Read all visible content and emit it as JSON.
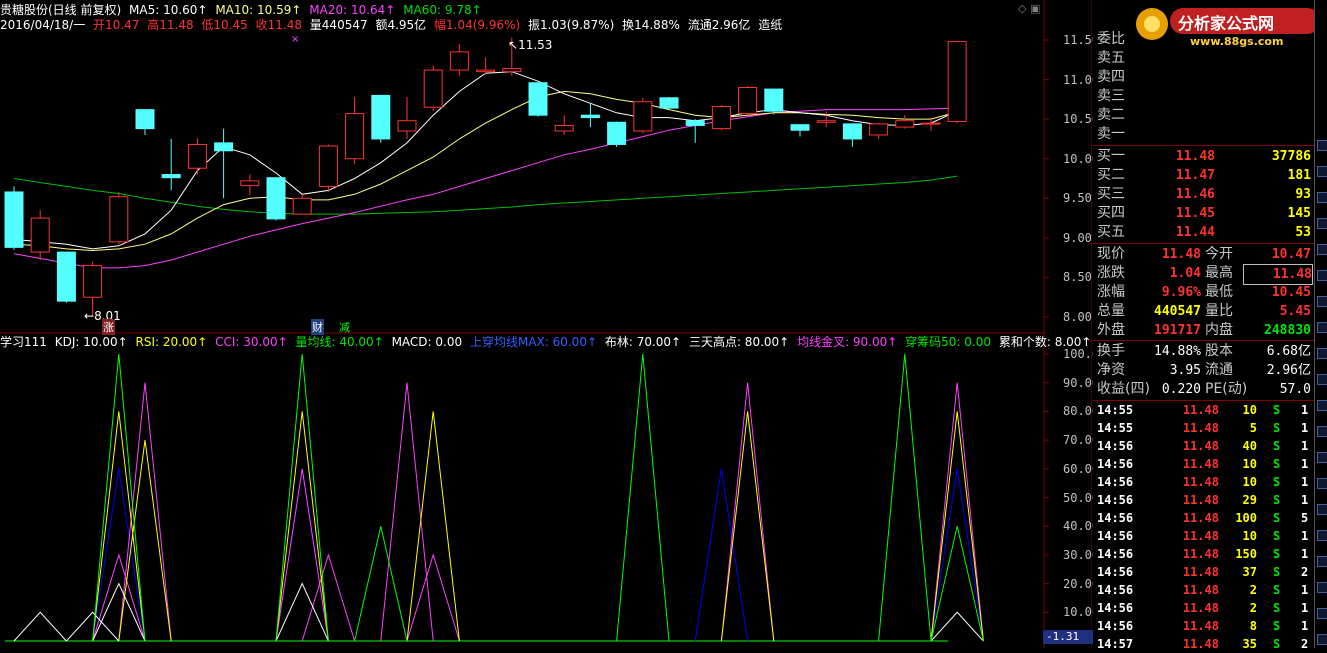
{
  "header": {
    "stock_title": "贵糖股份(日线 前复权)",
    "ma5": "MA5: 10.60↑",
    "ma10": "MA10: 10.59↑",
    "ma20": "MA20: 10.64↑",
    "ma60": "MA60: 9.78↑",
    "date": "2016/04/18/一",
    "open": "开10.47",
    "high": "高11.48",
    "low": "低10.45",
    "close": "收11.48",
    "volume": "量440547",
    "amount": "额4.95亿",
    "change_pct": "幅1.04(9.96%)",
    "amplitude": "振1.03(9.87%)",
    "turnover": "换14.88%",
    "float": "流通2.96亿",
    "industry": "造纸"
  },
  "price_axis": [
    "11.50",
    "11.00",
    "10.50",
    "10.00",
    "9.50",
    "9.00",
    "8.50",
    "8.00"
  ],
  "indicator_axis": [
    "100.0",
    "90.00",
    "80.00",
    "70.00",
    "60.00",
    "50.00",
    "40.00",
    "30.00",
    "20.00",
    "10.00"
  ],
  "indicator_axis_bottom": "-1.31",
  "annotations": {
    "high_mark": "11.53",
    "low_mark": "8.01",
    "zhang_tag": "涨",
    "cai_tag": "财",
    "jian_tag": "减"
  },
  "indicator_header": {
    "name": "学习111",
    "kdj": "KDJ: 10.00↑",
    "rsi": "RSI: 20.00↑",
    "cci": "CCI: 30.00↑",
    "vol_ma": "量均线: 40.00↑",
    "macd": "MACD: 0.00",
    "shangchuan": "上穿均线MAX: 60.00↑",
    "boll": "布林: 70.00↑",
    "santian": "三天高点: 80.00↑",
    "junxian": "均线金叉: 90.00↑",
    "chouma": "穿筹码50: 0.00",
    "leihe": "累和个数: 8.00↑"
  },
  "colors": {
    "up": "#ff3232",
    "down": "#54ffff",
    "ma5": "#ffffff",
    "ma10": "#ffff80",
    "ma20": "#ff40ff",
    "ma60": "#00c000",
    "kdj": "#ffffff",
    "rsi": "#ffff00",
    "cci": "#ff40ff",
    "vol": "#00ff00",
    "macd": "#0000ff"
  },
  "logo": {
    "title": "分析家公式网",
    "url": "www.88gs.com"
  },
  "panel": {
    "weibi": "委比",
    "asks": [
      {
        "label": "卖五",
        "price": "",
        "vol": ""
      },
      {
        "label": "卖四",
        "price": "",
        "vol": ""
      },
      {
        "label": "卖三",
        "price": "",
        "vol": ""
      },
      {
        "label": "卖二",
        "price": "",
        "vol": ""
      },
      {
        "label": "卖一",
        "price": "",
        "vol": ""
      }
    ],
    "bids": [
      {
        "label": "买一",
        "price": "11.48",
        "vol": "37786"
      },
      {
        "label": "买二",
        "price": "11.47",
        "vol": "181"
      },
      {
        "label": "买三",
        "price": "11.46",
        "vol": "93"
      },
      {
        "label": "买四",
        "price": "11.45",
        "vol": "145"
      },
      {
        "label": "买五",
        "price": "11.44",
        "vol": "53"
      }
    ],
    "quote": [
      {
        "l1": "现价",
        "v1": "11.48",
        "l2": "今开",
        "v2": "10.47"
      },
      {
        "l1": "涨跌",
        "v1": "1.04",
        "l2": "最高",
        "v2": "11.48"
      },
      {
        "l1": "涨幅",
        "v1": "9.96%",
        "l2": "最低",
        "v2": "10.45"
      },
      {
        "l1": "总量",
        "v1": "440547",
        "l2": "量比",
        "v2": "5.45"
      },
      {
        "l1": "外盘",
        "v1": "191717",
        "l2": "内盘",
        "v2": "248830"
      }
    ],
    "fund": [
      {
        "l1": "换手",
        "v1": "14.88%",
        "l2": "股本",
        "v2": "6.68亿"
      },
      {
        "l1": "净资",
        "v1": "3.95",
        "l2": "流通",
        "v2": "2.96亿"
      },
      {
        "l1": "收益(四)",
        "v1": "0.220",
        "l2": "PE(动)",
        "v2": "57.0"
      }
    ],
    "ticks": [
      {
        "time": "14:55",
        "price": "11.48",
        "vol": "10",
        "side": "S",
        "n": "1"
      },
      {
        "time": "14:55",
        "price": "11.48",
        "vol": "5",
        "side": "S",
        "n": "1"
      },
      {
        "time": "14:56",
        "price": "11.48",
        "vol": "40",
        "side": "S",
        "n": "1"
      },
      {
        "time": "14:56",
        "price": "11.48",
        "vol": "10",
        "side": "S",
        "n": "1"
      },
      {
        "time": "14:56",
        "price": "11.48",
        "vol": "10",
        "side": "S",
        "n": "1"
      },
      {
        "time": "14:56",
        "price": "11.48",
        "vol": "29",
        "side": "S",
        "n": "1"
      },
      {
        "time": "14:56",
        "price": "11.48",
        "vol": "100",
        "side": "S",
        "n": "5"
      },
      {
        "time": "14:56",
        "price": "11.48",
        "vol": "10",
        "side": "S",
        "n": "1"
      },
      {
        "time": "14:56",
        "price": "11.48",
        "vol": "150",
        "side": "S",
        "n": "1"
      },
      {
        "time": "14:56",
        "price": "11.48",
        "vol": "37",
        "side": "S",
        "n": "2"
      },
      {
        "time": "14:56",
        "price": "11.48",
        "vol": "2",
        "side": "S",
        "n": "1"
      },
      {
        "time": "14:56",
        "price": "11.48",
        "vol": "2",
        "side": "S",
        "n": "1"
      },
      {
        "time": "14:56",
        "price": "11.48",
        "vol": "8",
        "side": "S",
        "n": "1"
      },
      {
        "time": "14:57",
        "price": "11.48",
        "vol": "35",
        "side": "S",
        "n": "2"
      }
    ]
  },
  "candles": [
    {
      "o": 9.58,
      "h": 9.65,
      "l": 8.85,
      "c": 8.88
    },
    {
      "o": 8.82,
      "h": 9.35,
      "l": 8.72,
      "c": 9.25
    },
    {
      "o": 8.82,
      "h": 8.82,
      "l": 8.18,
      "c": 8.2
    },
    {
      "o": 8.25,
      "h": 8.7,
      "l": 8.01,
      "c": 8.65
    },
    {
      "o": 8.95,
      "h": 9.58,
      "l": 8.92,
      "c": 9.52
    },
    {
      "o": 10.62,
      "h": 10.62,
      "l": 10.3,
      "c": 10.38
    },
    {
      "o": 9.8,
      "h": 10.25,
      "l": 9.6,
      "c": 9.76
    },
    {
      "o": 9.88,
      "h": 10.26,
      "l": 9.8,
      "c": 10.18
    },
    {
      "o": 10.2,
      "h": 10.38,
      "l": 9.5,
      "c": 10.1
    },
    {
      "o": 9.66,
      "h": 9.8,
      "l": 9.54,
      "c": 9.72
    },
    {
      "o": 9.76,
      "h": 9.76,
      "l": 9.22,
      "c": 9.24
    },
    {
      "o": 9.3,
      "h": 9.55,
      "l": 9.3,
      "c": 9.5
    },
    {
      "o": 9.65,
      "h": 10.18,
      "l": 9.58,
      "c": 10.16
    },
    {
      "o": 10.0,
      "h": 10.78,
      "l": 9.93,
      "c": 10.57
    },
    {
      "o": 10.8,
      "h": 10.8,
      "l": 10.2,
      "c": 10.25
    },
    {
      "o": 10.35,
      "h": 10.78,
      "l": 10.25,
      "c": 10.48
    },
    {
      "o": 10.65,
      "h": 11.18,
      "l": 10.6,
      "c": 11.12
    },
    {
      "o": 11.12,
      "h": 11.45,
      "l": 11.05,
      "c": 11.35
    },
    {
      "o": 11.1,
      "h": 11.28,
      "l": 11.07,
      "c": 11.12
    },
    {
      "o": 11.1,
      "h": 11.53,
      "l": 11.05,
      "c": 11.14
    },
    {
      "o": 10.96,
      "h": 10.96,
      "l": 10.53,
      "c": 10.55
    },
    {
      "o": 10.35,
      "h": 10.55,
      "l": 10.3,
      "c": 10.42
    },
    {
      "o": 10.55,
      "h": 10.7,
      "l": 10.4,
      "c": 10.52
    },
    {
      "o": 10.46,
      "h": 10.47,
      "l": 10.15,
      "c": 10.18
    },
    {
      "o": 10.35,
      "h": 10.77,
      "l": 10.32,
      "c": 10.72
    },
    {
      "o": 10.77,
      "h": 10.78,
      "l": 10.62,
      "c": 10.64
    },
    {
      "o": 10.48,
      "h": 10.5,
      "l": 10.2,
      "c": 10.42
    },
    {
      "o": 10.38,
      "h": 10.68,
      "l": 10.36,
      "c": 10.66
    },
    {
      "o": 10.57,
      "h": 10.92,
      "l": 10.55,
      "c": 10.9
    },
    {
      "o": 10.88,
      "h": 10.88,
      "l": 10.56,
      "c": 10.6
    },
    {
      "o": 10.43,
      "h": 10.43,
      "l": 10.28,
      "c": 10.36
    },
    {
      "o": 10.46,
      "h": 10.6,
      "l": 10.4,
      "c": 10.48
    },
    {
      "o": 10.44,
      "h": 10.44,
      "l": 10.15,
      "c": 10.25
    },
    {
      "o": 10.3,
      "h": 10.45,
      "l": 10.25,
      "c": 10.44
    },
    {
      "o": 10.4,
      "h": 10.55,
      "l": 10.38,
      "c": 10.48
    },
    {
      "o": 10.44,
      "h": 10.52,
      "l": 10.35,
      "c": 10.45
    },
    {
      "o": 10.47,
      "h": 11.48,
      "l": 10.45,
      "c": 11.48
    }
  ],
  "ma": {
    "ma5": [
      8.98,
      8.95,
      8.92,
      8.86,
      8.9,
      9.05,
      9.35,
      9.85,
      10.15,
      10.05,
      9.82,
      9.55,
      9.6,
      9.75,
      9.95,
      10.2,
      10.55,
      10.85,
      11.08,
      11.1,
      10.98,
      10.82,
      10.7,
      10.58,
      10.52,
      10.52,
      10.48,
      10.52,
      10.58,
      10.62,
      10.58,
      10.55,
      10.48,
      10.43,
      10.42,
      10.45,
      10.6
    ],
    "ma10": [
      8.92,
      8.9,
      8.86,
      8.84,
      8.86,
      8.92,
      9.05,
      9.25,
      9.42,
      9.5,
      9.52,
      9.48,
      9.48,
      9.55,
      9.68,
      9.85,
      10.02,
      10.25,
      10.45,
      10.62,
      10.78,
      10.85,
      10.82,
      10.75,
      10.7,
      10.62,
      10.55,
      10.52,
      10.55,
      10.58,
      10.58,
      10.56,
      10.55,
      10.52,
      10.5,
      10.5,
      10.59
    ],
    "ma20": [
      8.8,
      8.74,
      8.68,
      8.62,
      8.62,
      8.65,
      8.72,
      8.82,
      8.92,
      9.02,
      9.1,
      9.18,
      9.25,
      9.32,
      9.4,
      9.48,
      9.55,
      9.65,
      9.75,
      9.85,
      9.95,
      10.05,
      10.12,
      10.2,
      10.28,
      10.36,
      10.42,
      10.48,
      10.53,
      10.58,
      10.6,
      10.62,
      10.62,
      10.62,
      10.62,
      10.63,
      10.64
    ],
    "ma60": [
      9.75,
      9.7,
      9.65,
      9.6,
      9.56,
      9.5,
      9.45,
      9.4,
      9.36,
      9.33,
      9.31,
      9.3,
      9.3,
      9.3,
      9.31,
      9.32,
      9.33,
      9.35,
      9.37,
      9.39,
      9.42,
      9.44,
      9.46,
      9.48,
      9.5,
      9.52,
      9.54,
      9.56,
      9.58,
      9.6,
      9.62,
      9.64,
      9.66,
      9.68,
      9.7,
      9.73,
      9.78
    ]
  },
  "signals": {
    "kdj": [
      0,
      10,
      0,
      10,
      20,
      0,
      0,
      0,
      0,
      0,
      0,
      20,
      0,
      0,
      0,
      0,
      0,
      0,
      0,
      0,
      0,
      0,
      0,
      0,
      0,
      0,
      0,
      0,
      0,
      0,
      0,
      0,
      0,
      0,
      0,
      0,
      10
    ],
    "vol": [
      0,
      0,
      0,
      0,
      100,
      0,
      0,
      0,
      0,
      0,
      0,
      100,
      0,
      0,
      40,
      0,
      0,
      0,
      0,
      0,
      0,
      0,
      0,
      0,
      100,
      0,
      0,
      0,
      0,
      0,
      0,
      0,
      0,
      0,
      100,
      0,
      40
    ],
    "cci": [
      0,
      0,
      0,
      0,
      30,
      90,
      0,
      0,
      0,
      0,
      0,
      60,
      30,
      0,
      0,
      90,
      30,
      0,
      0,
      0,
      0,
      0,
      0,
      0,
      0,
      0,
      0,
      0,
      90,
      0,
      0,
      0,
      0,
      0,
      0,
      0,
      90
    ],
    "macd": [
      0,
      0,
      0,
      0,
      60,
      0,
      0,
      0,
      0,
      0,
      0,
      60,
      0,
      0,
      0,
      0,
      0,
      0,
      0,
      0,
      0,
      0,
      0,
      0,
      0,
      0,
      0,
      60,
      0,
      0,
      0,
      0,
      0,
      0,
      0,
      0,
      60
    ],
    "rsi": [
      0,
      0,
      0,
      0,
      80,
      70,
      0,
      0,
      0,
      0,
      0,
      80,
      0,
      0,
      0,
      0,
      80,
      0,
      0,
      0,
      0,
      0,
      0,
      0,
      0,
      0,
      0,
      0,
      80,
      0,
      0,
      0,
      0,
      0,
      0,
      0,
      80
    ]
  }
}
